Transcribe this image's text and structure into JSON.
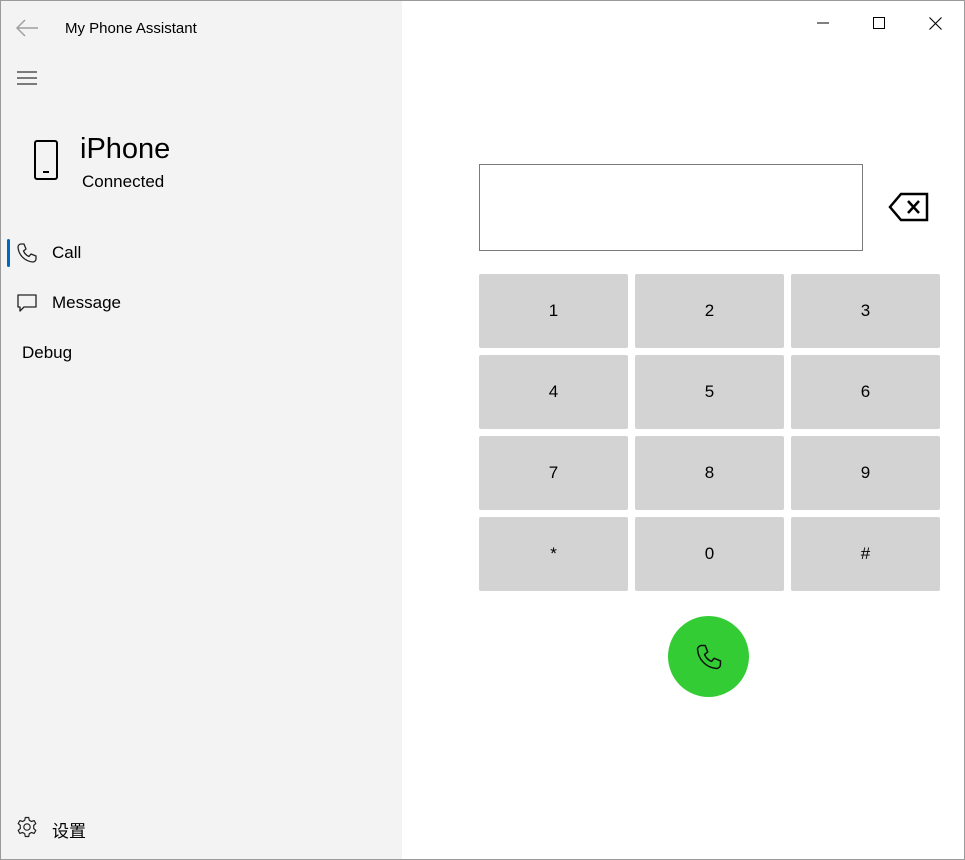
{
  "window": {
    "title": "My Phone Assistant"
  },
  "device": {
    "name": "iPhone",
    "status": "Connected"
  },
  "nav": {
    "items": [
      {
        "label": "Call",
        "icon": "phone-icon",
        "active": true
      },
      {
        "label": "Message",
        "icon": "message-icon",
        "active": false
      },
      {
        "label": "Debug",
        "icon": "",
        "active": false
      }
    ],
    "settings_label": "设置"
  },
  "dialer": {
    "number_value": "",
    "keys": [
      "1",
      "2",
      "3",
      "4",
      "5",
      "6",
      "7",
      "8",
      "9",
      "*",
      "0",
      "#"
    ]
  },
  "colors": {
    "sidebar_bg": "#f3f3f3",
    "key_bg": "#d3d3d3",
    "call_button": "#34cc34",
    "active_indicator": "#0067c0"
  }
}
